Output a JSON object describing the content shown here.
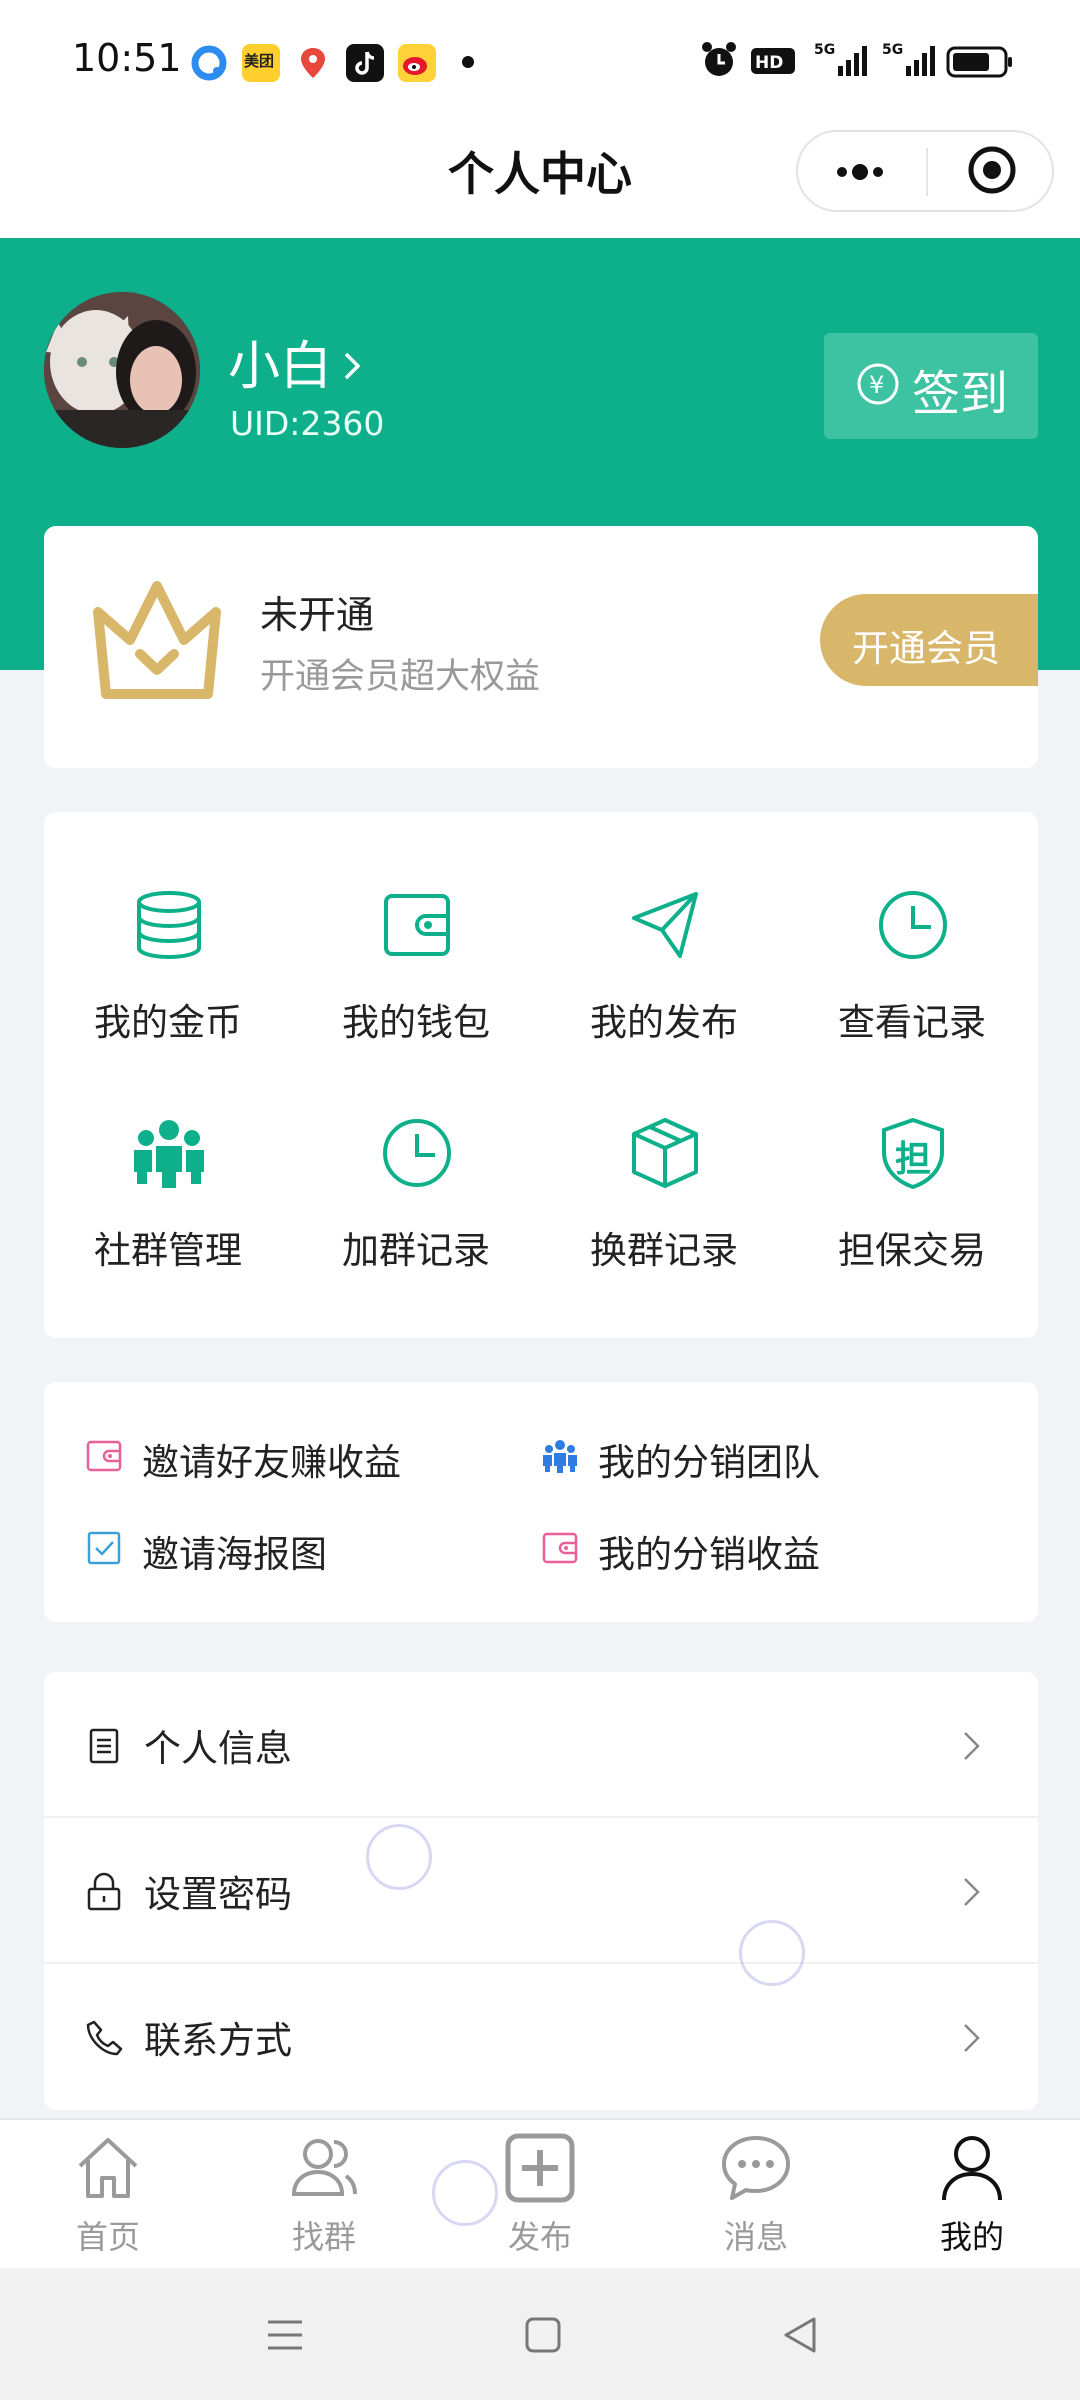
{
  "status_bar": {
    "time": "10:51",
    "apps": [
      "browser-icon",
      "meituan-icon",
      "map-icon",
      "tiktok-icon",
      "weibo-icon"
    ],
    "meituan_text": "美团"
  },
  "header": {
    "title": "个人中心"
  },
  "profile": {
    "name": "小白",
    "uid": "UID:2360",
    "checkin_label": "签到"
  },
  "membership": {
    "status": "未开通",
    "description": "开通会员超大权益",
    "button_label": "开通会员"
  },
  "grid": {
    "items": [
      {
        "label": "我的金币",
        "icon": "coins-database-icon"
      },
      {
        "label": "我的钱包",
        "icon": "wallet-icon"
      },
      {
        "label": "我的发布",
        "icon": "paper-plane-icon"
      },
      {
        "label": "查看记录",
        "icon": "clock-icon"
      },
      {
        "label": "社群管理",
        "icon": "group-icon"
      },
      {
        "label": "加群记录",
        "icon": "clock-icon"
      },
      {
        "label": "换群记录",
        "icon": "cube-icon"
      },
      {
        "label": "担保交易",
        "icon": "shield-guarantee-icon"
      }
    ],
    "shield_char": "担"
  },
  "invite": {
    "items": [
      {
        "label": "邀请好友赚收益",
        "icon": "wallet-icon"
      },
      {
        "label": "我的分销团队",
        "icon": "team-icon"
      },
      {
        "label": "邀请海报图",
        "icon": "checkbox-icon"
      },
      {
        "label": "我的分销收益",
        "icon": "wallet-icon"
      }
    ]
  },
  "settings": {
    "items": [
      {
        "label": "个人信息",
        "icon": "document-icon"
      },
      {
        "label": "设置密码",
        "icon": "lock-icon"
      },
      {
        "label": "联系方式",
        "icon": "phone-icon"
      }
    ]
  },
  "tabbar": {
    "items": [
      {
        "label": "首页",
        "icon": "home-icon"
      },
      {
        "label": "找群",
        "icon": "users-icon"
      },
      {
        "label": "发布",
        "icon": "plus-square-icon"
      },
      {
        "label": "消息",
        "icon": "chat-bubble-icon"
      },
      {
        "label": "我的",
        "icon": "user-icon",
        "active": true
      }
    ]
  },
  "colors": {
    "primary_green": "#0db08a",
    "gold": "#d9b76a",
    "pink_icon": "#e8609a",
    "blue_icon": "#2f7de0"
  }
}
